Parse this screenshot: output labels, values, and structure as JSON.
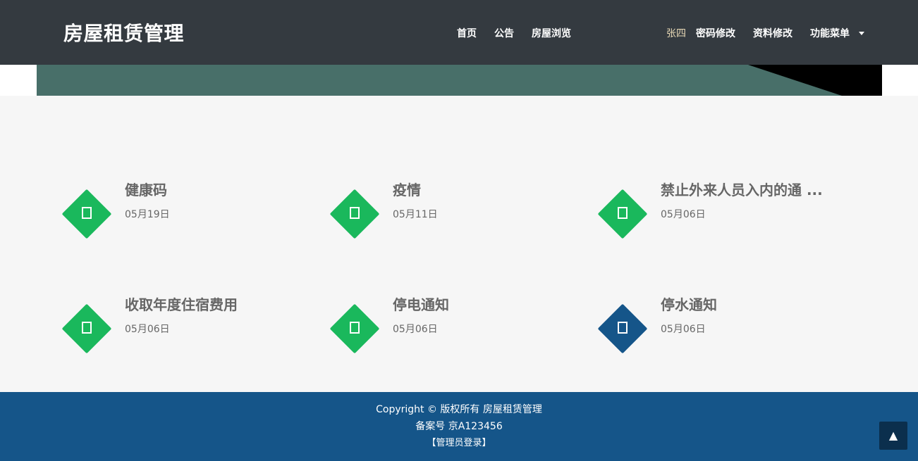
{
  "header": {
    "brand": "房屋租赁管理",
    "nav": [
      "首页",
      "公告",
      "房屋浏览"
    ],
    "user_name": "张四",
    "links": [
      "密码修改",
      "资料修改",
      "功能菜单"
    ]
  },
  "colors": {
    "header_bg": "#343a40",
    "banner": "#486f69",
    "notice_green": "#1ab85c",
    "notice_blue": "#155589",
    "footer_bg": "#155589"
  },
  "notices": [
    {
      "title": "健康码",
      "date": "05月19日",
      "icon": "doc-icon",
      "color": "#1ab85c"
    },
    {
      "title": "疫情",
      "date": "05月11日",
      "icon": "doc-icon",
      "color": "#1ab85c"
    },
    {
      "title": "禁止外来人员入内的通 ...",
      "date": "05月06日",
      "icon": "doc-icon",
      "color": "#1ab85c"
    },
    {
      "title": "收取年度住宿费用",
      "date": "05月06日",
      "icon": "doc-icon",
      "color": "#1ab85c"
    },
    {
      "title": "停电通知",
      "date": "05月06日",
      "icon": "doc-icon",
      "color": "#1ab85c"
    },
    {
      "title": "停水通知",
      "date": "05月06日",
      "icon": "doc-icon",
      "color": "#155589"
    }
  ],
  "footer": {
    "copyright": "Copyright © 版权所有 房屋租赁管理",
    "icp": "备案号 京A123456",
    "admin_login": "【管理员登录】"
  },
  "to_top": "▲"
}
